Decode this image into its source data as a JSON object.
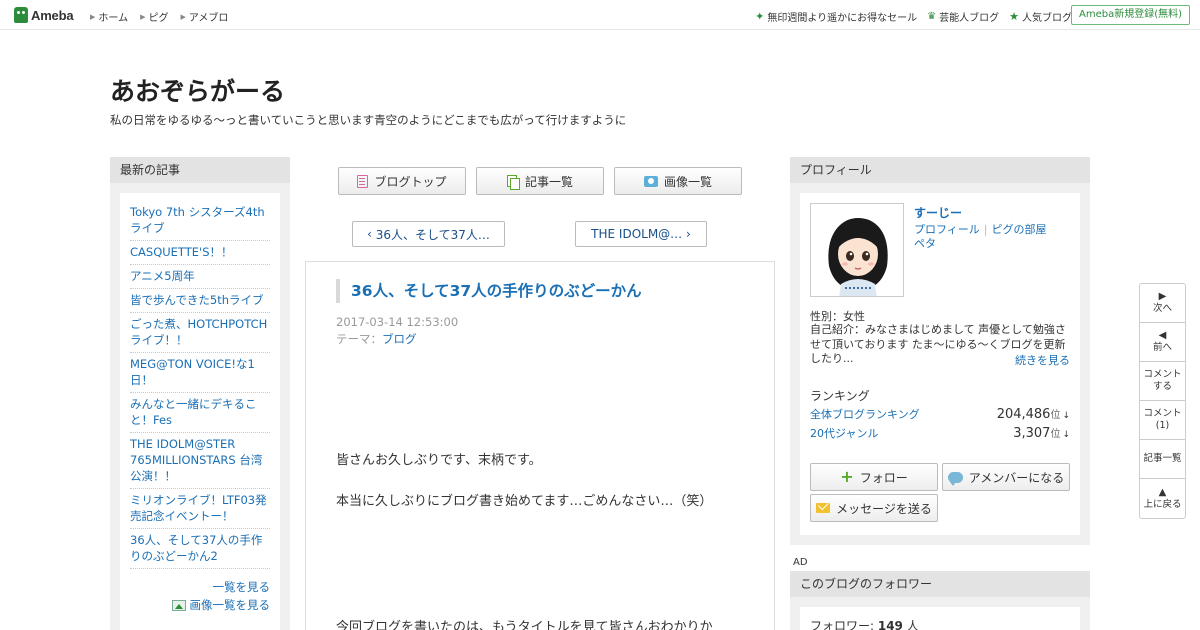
{
  "topbar": {
    "logo": "Ameba",
    "nav": [
      "ホーム",
      "ピグ",
      "アメブロ"
    ],
    "right_links": [
      "無印週間より遥かにお得なセール",
      "芸能人ブログ",
      "人気ブログ"
    ],
    "register": "Ameba新規登録(無料)"
  },
  "blog": {
    "title": "あおぞらがーる",
    "description": "私の日常をゆるゆる～っと書いていこうと思います青空のようにどこまでも広がって行けますように"
  },
  "left": {
    "heading": "最新の記事",
    "articles": [
      "Tokyo 7th シスターズ4thライブ",
      "CASQUETTE'S！！",
      "アニメ5周年",
      "皆で歩んできた5thライブ",
      "ごった煮、HOTCHPOTCHライブ！！",
      "MEG@TON VOICE!な1日！",
      "みんなと一緒にデキること！Fes",
      "THE IDOLM@STER 765MILLIONSTARS 台湾公演！！",
      "ミリオンライブ！LTF03発売記念イベントー！",
      "36人、そして37人の手作りのぶどーかん2"
    ],
    "see_all": "一覧を見る",
    "see_images": "画像一覧を見る"
  },
  "center": {
    "buttons": [
      "ブログトップ",
      "記事一覧",
      "画像一覧"
    ],
    "prev": "36人、そして37人…",
    "next": "THE IDOLM@…",
    "article": {
      "title": "36人、そして37人の手作りのぶどーかん",
      "date": "2017-03-14 12:53:00",
      "theme_label": "テーマ：",
      "theme": "ブログ",
      "p1": "皆さんお久しぶりです、末柄です。",
      "p2": "本当に久しぶりにブログ書き始めてます…ごめんなさい…（笑）",
      "p3": "今回ブログを書いたのは、もうタイトルを見て皆さんおわかりか"
    }
  },
  "profile": {
    "heading": "プロフィール",
    "name": "すーじー",
    "link_profile": "プロフィール",
    "link_room": "ピグの部屋",
    "link_peta": "ペタ",
    "gender": "性別：女性",
    "intro": "自己紹介：みなさまはじめまして 声優として勉強させて頂いております たま～にゆる～くブログを更新したり...",
    "more": "続きを見る",
    "ranking_heading": "ランキング",
    "ranks": [
      {
        "label": "全体ブログランキング",
        "value": "204,486",
        "unit": "位",
        "arrow": "↓"
      },
      {
        "label": "20代ジャンル",
        "value": "3,307",
        "unit": "位",
        "arrow": "↓"
      }
    ],
    "follow": "フォロー",
    "amember": "アメンバーになる",
    "message": "メッセージを送る"
  },
  "ad": "AD",
  "followers": {
    "heading": "このブログのフォロワー",
    "label": "フォロワー: ",
    "count": "149",
    "unit": " 人"
  },
  "sidenav": {
    "next": "次へ",
    "prev": "前へ",
    "comment_line1": "コメント",
    "comment_line2": "する",
    "comments_line1": "コメント",
    "comments_line2": "(1)",
    "list": "記事一覧",
    "top": "上に戻る"
  }
}
